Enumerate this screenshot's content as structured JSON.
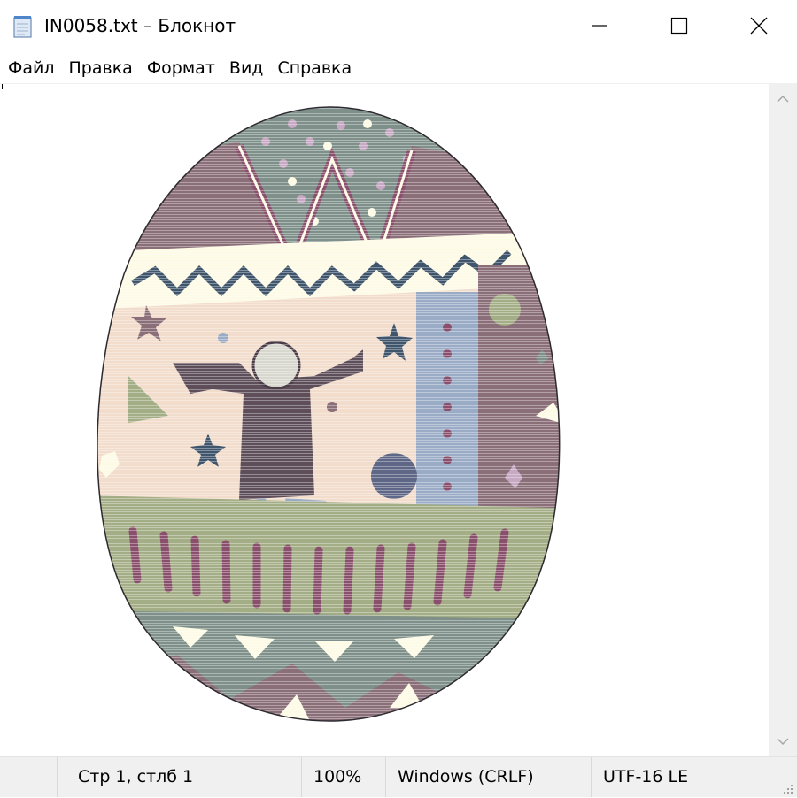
{
  "window": {
    "title": "IN0058.txt – Блокнот",
    "app_icon": "notepad-icon"
  },
  "controls": {
    "minimize_icon": "minimize-icon",
    "maximize_icon": "maximize-icon",
    "close_icon": "close-icon"
  },
  "menu": {
    "items": [
      {
        "label": "Файл"
      },
      {
        "label": "Правка"
      },
      {
        "label": "Формат"
      },
      {
        "label": "Вид"
      },
      {
        "label": "Справка"
      }
    ]
  },
  "editor": {
    "content": "ascii-art-easter-egg-image"
  },
  "statusbar": {
    "position": "Стр 1, стлб 1",
    "zoom": "100%",
    "line_ending": "Windows (CRLF)",
    "encoding": "UTF-16 LE"
  },
  "colors": {
    "egg_slate": "#7e9089",
    "egg_mauve": "#8a6e78",
    "egg_cream": "#fdfbe6",
    "egg_peach": "#f2dccb",
    "egg_blue": "#9aabc6",
    "egg_olive": "#a3ad86",
    "egg_navy": "#3f556b",
    "egg_plum": "#8a4f6c",
    "egg_lilac": "#c8a9c4"
  }
}
